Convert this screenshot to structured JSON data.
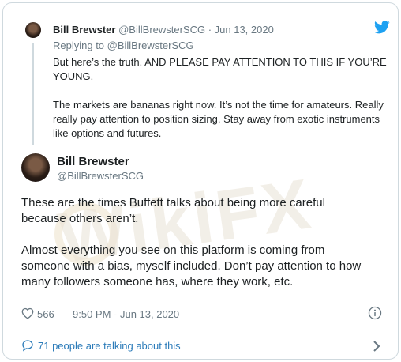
{
  "parent_tweet": {
    "author_name": "Bill Brewster",
    "meta": "@BillBrewsterSCG · Jun 13, 2020",
    "replying_to": "Replying to @BillBrewsterSCG",
    "paragraphs": [
      "But here’s the truth. AND PLEASE PAY ATTENTION TO THIS IF YOU’RE YOUNG.",
      "The markets are bananas right now. It’s not the time for amateurs. Really really pay attention to position sizing. Stay away from exotic instruments like options and futures."
    ]
  },
  "tweet": {
    "author_name": "Bill Brewster",
    "handle": "@BillBrewsterSCG",
    "paragraphs": [
      "These are the times Buffett talks about being more careful because others aren’t.",
      "Almost everything you see on this platform is coming from someone with a bias, myself included. Don’t pay attention to how many followers someone has, where they work, etc."
    ],
    "like_count": "566",
    "timestamp": "9:50 PM - Jun 13, 2020"
  },
  "footer": {
    "talking_text": "71 people are talking about this"
  },
  "watermark": "WikiFX",
  "colors": {
    "twitter_blue": "#1da1f2",
    "link_blue": "#2b7bb9",
    "meta_gray": "#697882"
  },
  "icons": [
    "twitter-bird-icon",
    "heart-icon",
    "info-icon",
    "comment-icon",
    "chevron-right-icon"
  ]
}
